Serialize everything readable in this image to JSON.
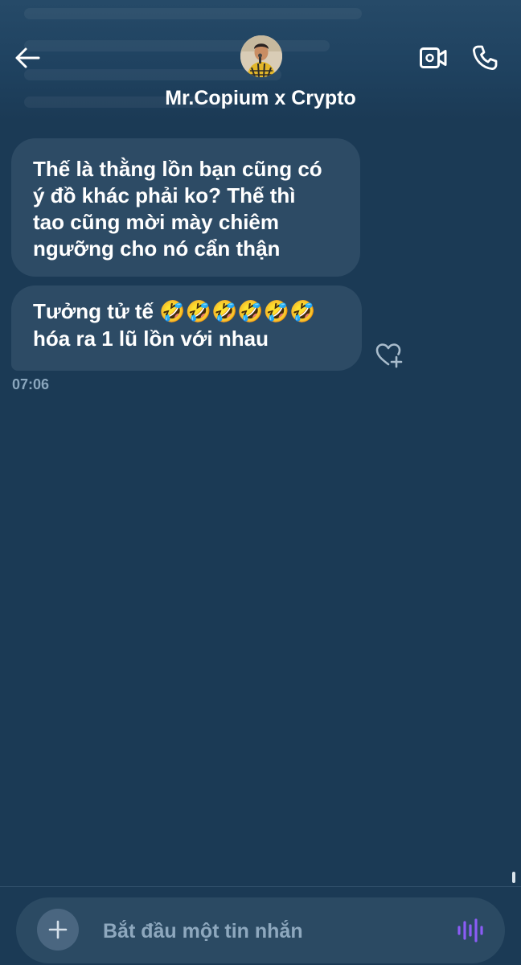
{
  "header": {
    "contact_name": "Mr.Copium x Crypto",
    "back_icon": "arrow-left-icon",
    "video_icon": "video-camera-icon",
    "call_icon": "phone-icon"
  },
  "messages": [
    {
      "text": "Thế là thằng lồn bạn cũng có\ný đồ khác phải ko? Thế thì\ntao cũng mời mày chiêm\nngưỡng cho nó cẩn thận"
    },
    {
      "text_before_emoji": "Tưởng tử tế ",
      "emoji": "🤣🤣🤣🤣🤣🤣",
      "text_after_emoji": "hóa ra 1 lũ lồn với nhau",
      "timestamp": "07:06"
    }
  ],
  "composer": {
    "placeholder": "Bắt đầu một tin nhắn",
    "add_icon": "plus-icon",
    "voice_icon": "voice-wave-icon"
  },
  "colors": {
    "background": "#1b3a55",
    "bubble": "#2d4b65",
    "accent_voice": "#8b5cf6",
    "timestamp": "#8aa6bd",
    "placeholder": "#8ea8be"
  }
}
